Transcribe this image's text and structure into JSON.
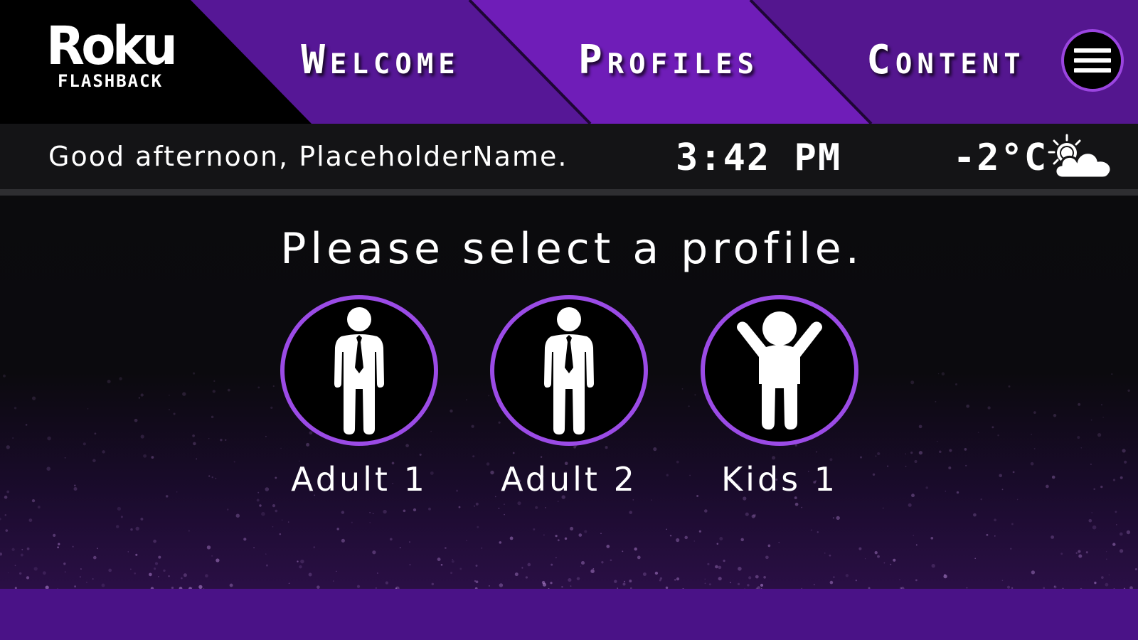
{
  "logo": {
    "main": "Roku",
    "sub": "FLASHBACK"
  },
  "nav": {
    "tabs": [
      {
        "label": "Welcome",
        "active": false
      },
      {
        "label": "Profiles",
        "active": true
      },
      {
        "label": "Content",
        "active": false
      }
    ],
    "menu_icon": "hamburger-menu-icon"
  },
  "infobar": {
    "greeting": "Good afternoon, PlaceholderName.",
    "time": "3:42 PM",
    "temperature": "-2°C",
    "weather_icon": "partly-cloudy-icon"
  },
  "main": {
    "prompt": "Please select a profile.",
    "profiles": [
      {
        "label": "Adult 1",
        "icon": "adult-icon"
      },
      {
        "label": "Adult 2",
        "icon": "adult-icon"
      },
      {
        "label": "Kids 1",
        "icon": "child-icon"
      }
    ]
  },
  "colors": {
    "brand_purple": "#4a1287",
    "active_tab_purple": "#6f1db8",
    "ring_purple": "#9b4be6",
    "background": "#0b0b0d"
  }
}
